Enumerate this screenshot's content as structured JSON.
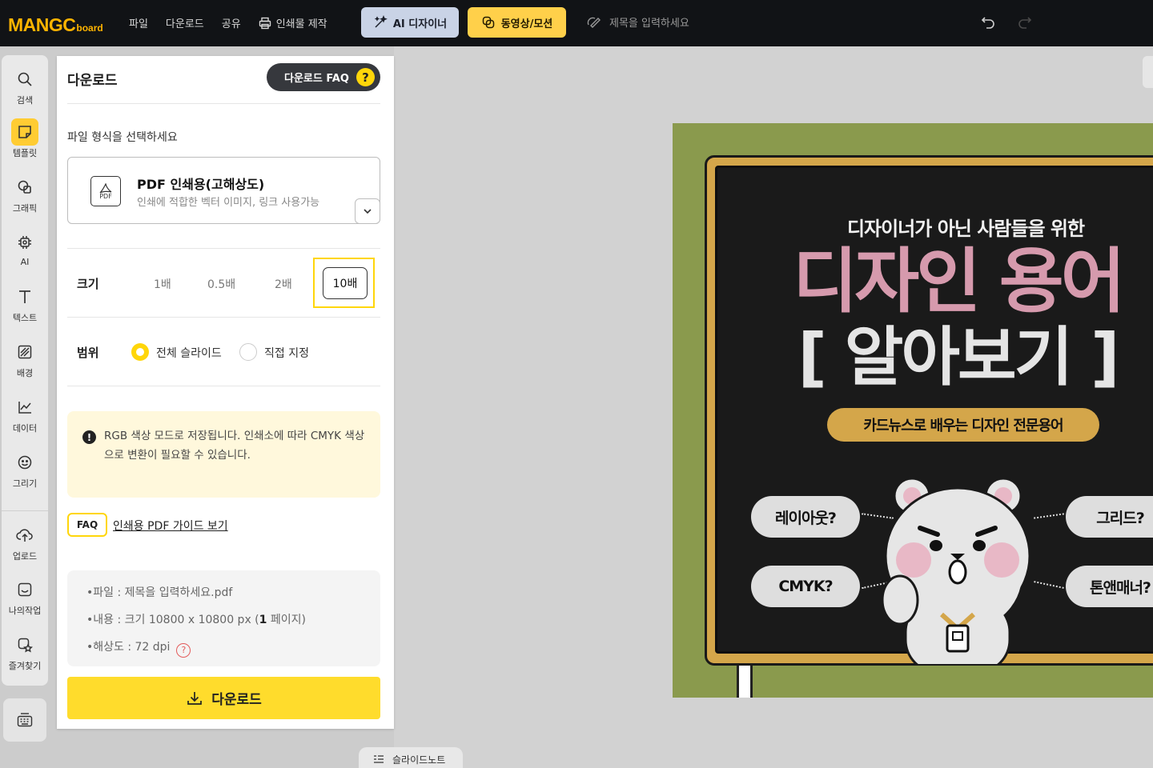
{
  "app": {
    "logo_main": "MANGC",
    "logo_sub": "board",
    "menu": [
      "파일",
      "다운로드",
      "공유"
    ],
    "print_label": "인쇄물 제작",
    "ai_designer_label": "AI 디자이너",
    "video_label": "동영상/모션",
    "title_placeholder": "제목을 입력하세요",
    "accent_color": "#ffd60a"
  },
  "sidebar": {
    "items": [
      {
        "label": "검색",
        "icon": "search-icon"
      },
      {
        "label": "템플릿",
        "icon": "template-icon"
      },
      {
        "label": "그래픽",
        "icon": "graphic-icon"
      },
      {
        "label": "AI",
        "icon": "ai-chip-icon"
      },
      {
        "label": "텍스트",
        "icon": "text-icon"
      },
      {
        "label": "배경",
        "icon": "background-icon"
      },
      {
        "label": "데이터",
        "icon": "chart-icon"
      },
      {
        "label": "그리기",
        "icon": "draw-icon"
      },
      {
        "label": "업로드",
        "icon": "upload-icon"
      },
      {
        "label": "나의작업",
        "icon": "my-work-icon"
      },
      {
        "label": "즐겨찾기",
        "icon": "favorite-icon"
      }
    ],
    "active": "템플릿"
  },
  "download_panel": {
    "title": "다운로드",
    "faq_button": "다운로드 FAQ",
    "format_prompt": "파일 형식을 선택하세요",
    "format": {
      "icon_text": "PDF",
      "name": "PDF 인쇄용(고해상도)",
      "description": "인쇄에 적합한 벡터 이미지, 링크 사용가능"
    },
    "size_label": "크기",
    "size_options": [
      "1배",
      "0.5배",
      "2배",
      "10배"
    ],
    "size_selected": "10배",
    "range_label": "범위",
    "range_options": [
      "전체 슬라이드",
      "직접 지정"
    ],
    "range_selected": "전체 슬라이드",
    "notice": "RGB 색상 모드로 저장됩니다. 인쇄소에 따라 CMYK 색상으로 변환이 필요할 수 있습니다.",
    "faq_badge": "FAQ",
    "faq_link": "인쇄용 PDF 가이드 보기",
    "info": {
      "file": "•파일 : 제목을 입력하세요.pdf",
      "content_prefix": "•내용 : 크기 10800 x 10800 px (",
      "content_pages": "1",
      "content_suffix": " 페이지)",
      "resolution": "•해상도 : 72 dpi"
    },
    "download_button": "다운로드"
  },
  "slide": {
    "subtitle": "디자이너가 아닌 사람들을 위한",
    "title_line1": "디자인 용어",
    "title_line2": "[ 알아보기 ]",
    "pill": "카드뉴스로 배우는 디자인 전문용어",
    "bubbles": [
      "레이아웃?",
      "CMYK?",
      "그리드?",
      "톤앤매너?"
    ]
  },
  "slide_note_label": "슬라이드노트"
}
